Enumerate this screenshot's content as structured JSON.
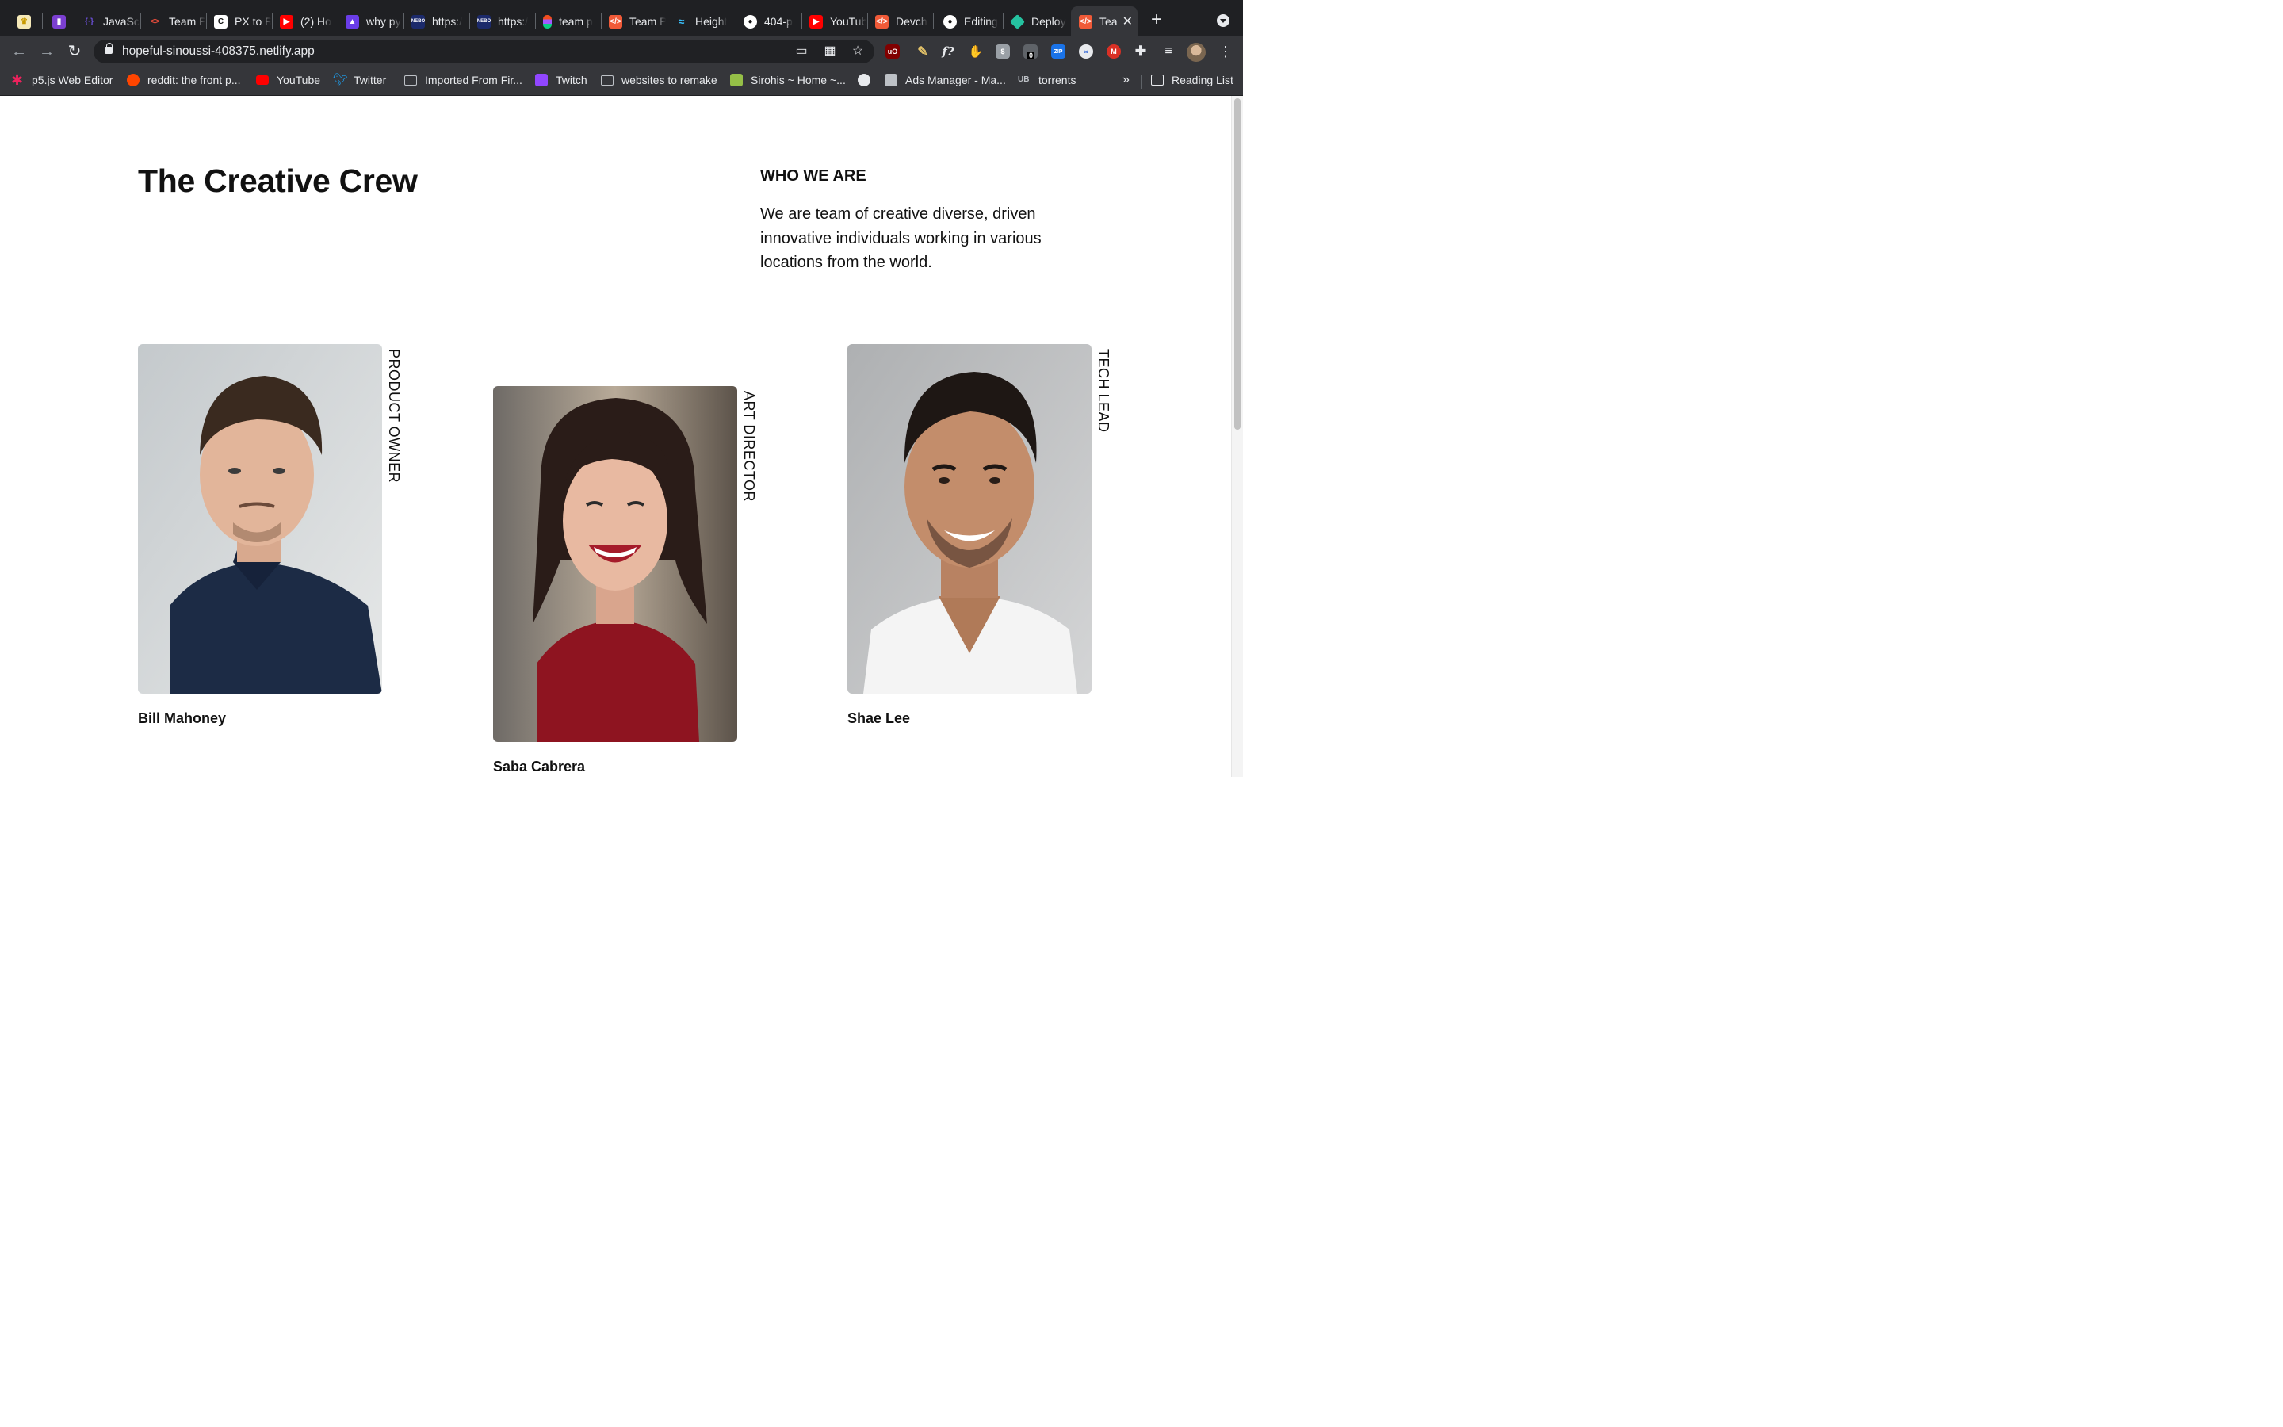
{
  "browser": {
    "tabs": [
      {
        "title": "",
        "icon": "crown-icon",
        "color": "#f2c94c"
      },
      {
        "title": "",
        "icon": "extension-icon",
        "color": "#7b3fd1"
      },
      {
        "title": "JavaSc",
        "icon": "code-brackets-icon",
        "color": "#6b4fd8"
      },
      {
        "title": "Team P",
        "icon": "code-arrows-icon",
        "color": "#e74c3c"
      },
      {
        "title": "PX to R",
        "icon": "c-letter-icon",
        "color": "#ffffff"
      },
      {
        "title": "(2) Ho",
        "icon": "youtube-icon",
        "color": "#ff0000"
      },
      {
        "title": "why py",
        "icon": "chart-icon",
        "color": "#6a3de8"
      },
      {
        "title": "https:/",
        "icon": "nebo-icon",
        "color": "#1c2a6b"
      },
      {
        "title": "https:/",
        "icon": "nebo-icon",
        "color": "#1c2a6b"
      },
      {
        "title": "team p",
        "icon": "figma-icon",
        "color": "#f24e1e"
      },
      {
        "title": "Team P",
        "icon": "devchallenges-icon",
        "color": "#f05a38"
      },
      {
        "title": "Height",
        "icon": "tailwind-icon",
        "color": "#38bdf8"
      },
      {
        "title": "404-p",
        "icon": "github-icon",
        "color": "#ffffff"
      },
      {
        "title": "YouTub",
        "icon": "youtube-icon",
        "color": "#ff0000"
      },
      {
        "title": "Devch",
        "icon": "devchallenges-icon",
        "color": "#f05a38"
      },
      {
        "title": "Editing",
        "icon": "github-icon",
        "color": "#ffffff"
      },
      {
        "title": "Deploy",
        "icon": "netlify-icon",
        "color": "#25c2a0"
      },
      {
        "title": "Tea",
        "icon": "devchallenges-icon",
        "color": "#f05a38",
        "active": true
      }
    ],
    "url": "hopeful-sinoussi-408375.netlify.app",
    "bookmarks": [
      {
        "label": "p5.js Web Editor",
        "icon": "p5-asterisk-icon",
        "color": "#ed225d"
      },
      {
        "label": "reddit: the front p...",
        "icon": "reddit-icon",
        "color": "#ff4500"
      },
      {
        "label": "YouTube",
        "icon": "youtube-icon",
        "color": "#ff0000"
      },
      {
        "label": "Twitter",
        "icon": "twitter-icon",
        "color": "#1da1f2"
      },
      {
        "label": "Imported From Fir...",
        "icon": "folder-icon",
        "color": "#bdc1c6"
      },
      {
        "label": "Twitch",
        "icon": "twitch-icon",
        "color": "#9146ff"
      },
      {
        "label": "websites to remake",
        "icon": "folder-icon",
        "color": "#bdc1c6"
      },
      {
        "label": "Sirohis ~ Home ~...",
        "icon": "shopify-icon",
        "color": "#95bf47"
      },
      {
        "label": "",
        "icon": "globe-icon",
        "color": "#e8eaed"
      },
      {
        "label": "Ads Manager - Ma...",
        "icon": "ads-manager-icon",
        "color": "#bdc1c6"
      },
      {
        "label": "torrents",
        "icon": "ub-icon",
        "color": "#bdc1c6"
      }
    ],
    "bookmarks_more": "»",
    "reading_list": "Reading List",
    "extension_badge": "0"
  },
  "page": {
    "title": "The Creative Crew",
    "who_heading": "WHO WE ARE",
    "who_text": "We are team of creative diverse, driven innovative individuals working in various locations from the world.",
    "members": [
      {
        "name": "Bill Mahoney",
        "role": "PRODUCT OWNER"
      },
      {
        "name": "Saba Cabrera",
        "role": "ART DIRECTOR"
      },
      {
        "name": "Shae Lee",
        "role": "TECH LEAD"
      }
    ]
  }
}
